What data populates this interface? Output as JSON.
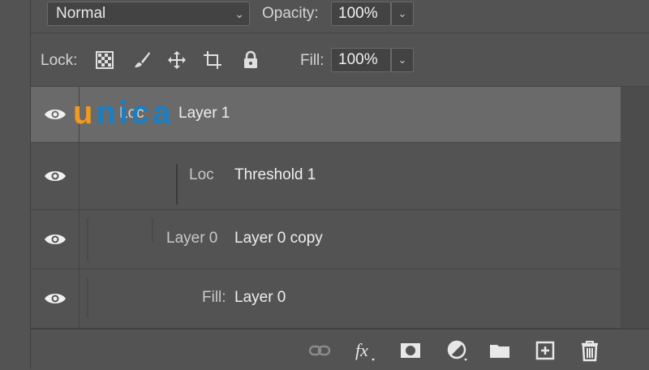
{
  "blend": {
    "mode": "Normal",
    "opacity_label": "Opacity:",
    "opacity_value": "100%"
  },
  "lock": {
    "label": "Lock:",
    "fill_label": "Fill:",
    "fill_value": "100%"
  },
  "layers": [
    {
      "name": "Layer 1",
      "ghost": "Loc",
      "visible": true,
      "selected": true
    },
    {
      "name": "Threshold 1",
      "ghost": "Loc",
      "visible": true,
      "selected": false
    },
    {
      "name": "Layer 0 copy",
      "ghost": "Layer 0",
      "visible": true,
      "selected": false
    },
    {
      "name": "Layer 0",
      "ghost": "Fill:",
      "visible": true,
      "selected": false
    }
  ],
  "watermark": {
    "u": "u",
    "rest": "nica"
  },
  "icons": [
    "link-icon",
    "fx-icon",
    "mask-icon",
    "adjustment-icon",
    "folder-icon",
    "new-layer-icon",
    "trash-icon"
  ],
  "colors": {
    "panel": "#535353",
    "selected_row": "#6a6a6a",
    "logo_orange": "#f39a1e",
    "logo_blue": "#1a7fc2"
  }
}
